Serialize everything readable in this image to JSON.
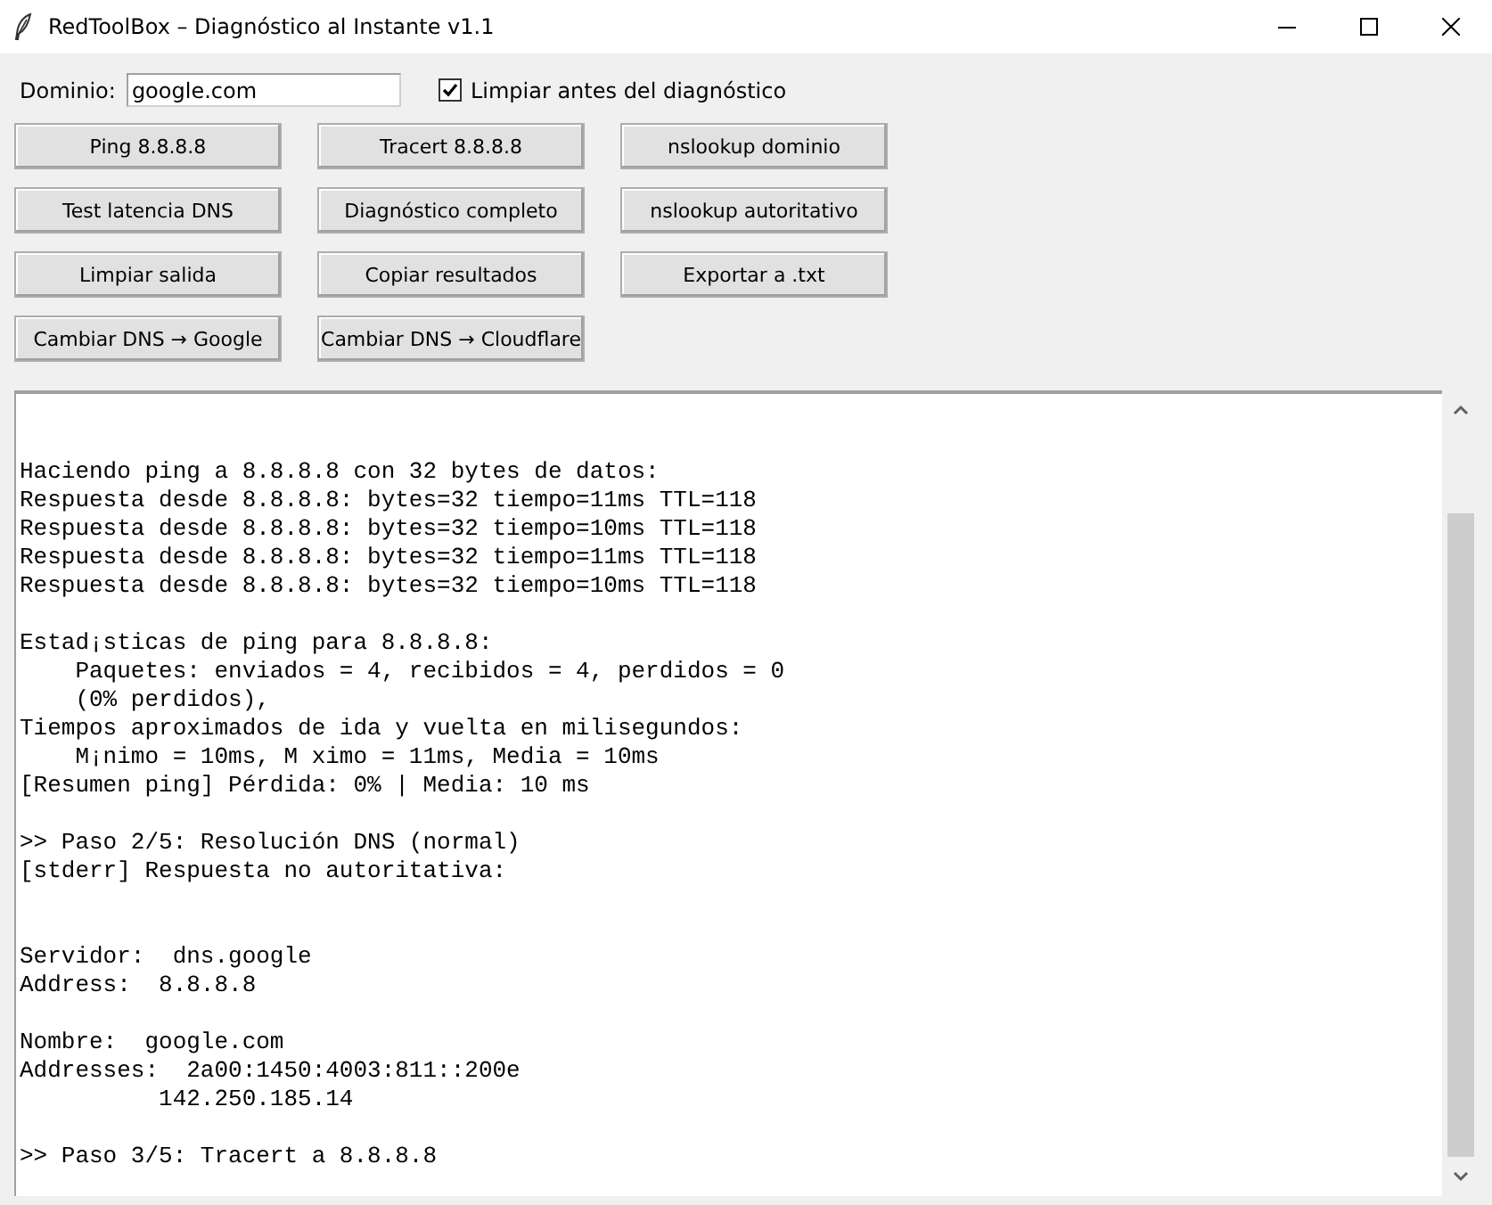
{
  "window": {
    "title": "RedToolBox – Diagnóstico al Instante v1.1"
  },
  "domain": {
    "label": "Dominio:",
    "value": "google.com"
  },
  "clear_before": {
    "label": "Limpiar antes del diagnóstico",
    "checked": true
  },
  "buttons": [
    {
      "label": "Ping 8.8.8.8"
    },
    {
      "label": "Tracert 8.8.8.8"
    },
    {
      "label": "nslookup dominio"
    },
    {
      "label": "Test latencia DNS"
    },
    {
      "label": "Diagnóstico completo"
    },
    {
      "label": "nslookup autoritativo"
    },
    {
      "label": "Limpiar salida"
    },
    {
      "label": "Copiar resultados"
    },
    {
      "label": "Exportar a .txt"
    },
    {
      "label": "Cambiar DNS → Google"
    },
    {
      "label": "Cambiar DNS → Cloudflare"
    }
  ],
  "output": {
    "text": "\n\nHaciendo ping a 8.8.8.8 con 32 bytes de datos:\nRespuesta desde 8.8.8.8: bytes=32 tiempo=11ms TTL=118\nRespuesta desde 8.8.8.8: bytes=32 tiempo=10ms TTL=118\nRespuesta desde 8.8.8.8: bytes=32 tiempo=11ms TTL=118\nRespuesta desde 8.8.8.8: bytes=32 tiempo=10ms TTL=118\n\nEstad¡sticas de ping para 8.8.8.8:\n    Paquetes: enviados = 4, recibidos = 4, perdidos = 0\n    (0% perdidos),\nTiempos aproximados de ida y vuelta en milisegundos:\n    M¡nimo = 10ms, M ximo = 11ms, Media = 10ms\n[Resumen ping] Pérdida: 0% | Media: 10 ms\n\n>> Paso 2/5: Resolución DNS (normal)\n[stderr] Respuesta no autoritativa:\n\n\nServidor:  dns.google\nAddress:  8.8.8.8\n\nNombre:  google.com\nAddresses:  2a00:1450:4003:811::200e\n          142.250.185.14\n\n>> Paso 3/5: Tracert a 8.8.8.8"
  }
}
